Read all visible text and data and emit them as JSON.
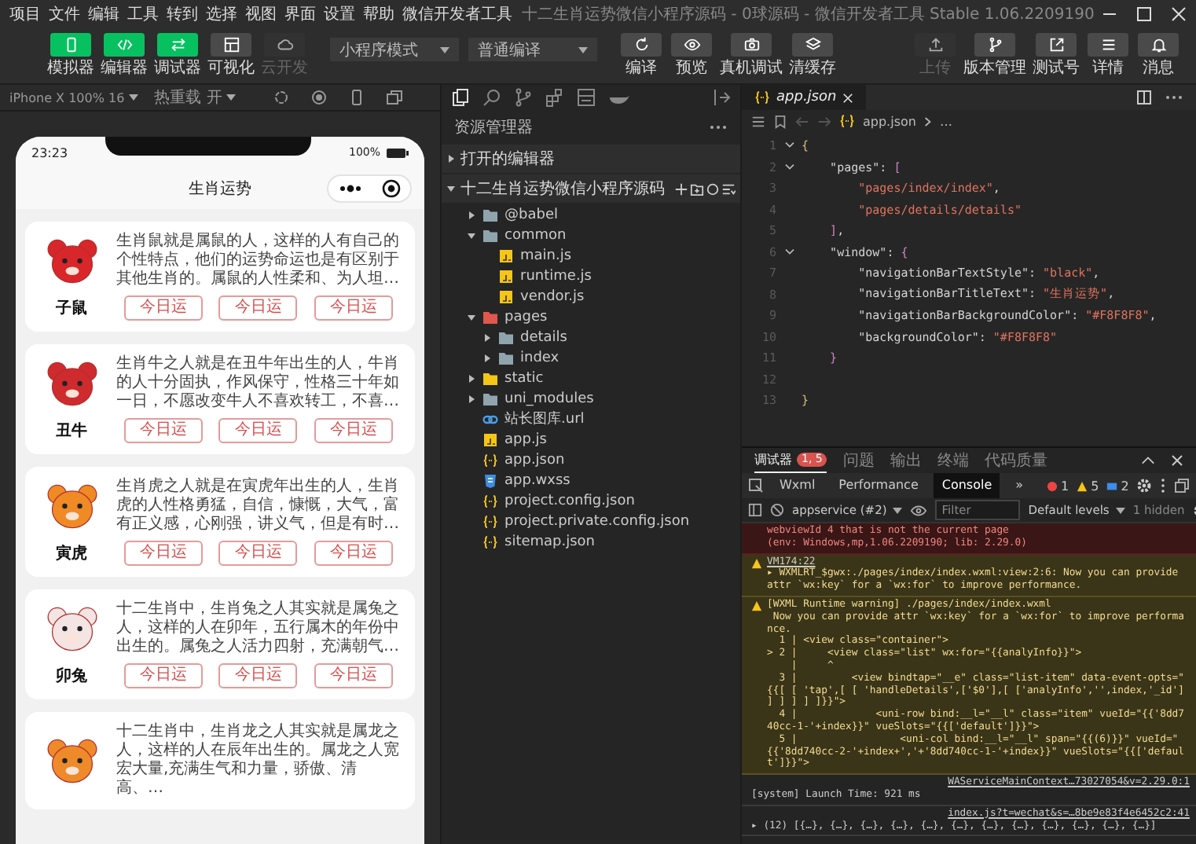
{
  "window": {
    "menu": [
      "项目",
      "文件",
      "编辑",
      "工具",
      "转到",
      "选择",
      "视图",
      "界面",
      "设置",
      "帮助",
      "微信开发者工具"
    ],
    "title": "十二生肖运势微信小程序源码 - 0球源码 - 微信开发者工具 Stable 1.06.2209190"
  },
  "toolbar": {
    "modes": [
      {
        "label": "模拟器",
        "on": true,
        "disabled": false
      },
      {
        "label": "编辑器",
        "on": true,
        "disabled": false
      },
      {
        "label": "调试器",
        "on": true,
        "disabled": false
      },
      {
        "label": "可视化",
        "on": false,
        "disabled": false
      },
      {
        "label": "云开发",
        "on": false,
        "disabled": true
      }
    ],
    "dropdowns": [
      "小程序模式",
      "普通编译"
    ],
    "actions": [
      "编译",
      "预览",
      "真机调试",
      "清缓存"
    ],
    "right": [
      {
        "label": "上传",
        "disabled": true
      },
      {
        "label": "版本管理",
        "disabled": false
      },
      {
        "label": "测试号",
        "disabled": false
      },
      {
        "label": "详情",
        "disabled": false
      },
      {
        "label": "消息",
        "disabled": false
      }
    ]
  },
  "simulator": {
    "device": "iPhone X 100% 16",
    "hot_reload": "热重载 开",
    "phone": {
      "time": "23:23",
      "battery": "100%",
      "title": "生肖运势",
      "cards": [
        {
          "name": "子鼠",
          "color": "#d9262b",
          "description": "生肖鼠就是属鼠的人，这样的人有自己的个性特点，他们的运势命运也是有区别于其他生肖的。属鼠的人性柔和、为人坦…",
          "buttons": [
            "今日运",
            "今日运",
            "今日运"
          ]
        },
        {
          "name": "丑牛",
          "color": "#cf2a2e",
          "description": "生肖牛之人就是在丑牛年出生的人，牛肖的人十分固执，作风保守，性格三十年如一日，不愿改变牛人不喜欢转工，不喜…",
          "buttons": [
            "今日运",
            "今日运",
            "今日运"
          ]
        },
        {
          "name": "寅虎",
          "color": "#f08a24",
          "description": "生肖虎之人就是在寅虎年出生的人，生肖虎的人性格勇猛，自信，慷慨，大气，富有正义感，心刚强，讲义气，但是有时…",
          "buttons": [
            "今日运",
            "今日运",
            "今日运"
          ]
        },
        {
          "name": "卯兔",
          "color": "#f4e4e4",
          "description": "十二生肖中，生肖兔之人其实就是属兔之人，这样的人在卯年，五行属木的年份中出生的。属兔之人活力四射，充满朝气…",
          "buttons": [
            "今日运",
            "今日运",
            "今日运"
          ]
        },
        {
          "color": "#ee8a2a",
          "description": "十二生肖中，生肖龙之人其实就是属龙之人，这样的人在辰年出生的。属龙之人宽宏大量,充满生气和力量，骄傲、清高、…"
        }
      ]
    }
  },
  "explorer": {
    "title": "资源管理器",
    "sections": [
      {
        "label": "打开的编辑器",
        "expanded": false
      },
      {
        "label": "十二生肖运势微信小程序源码",
        "expanded": true
      }
    ],
    "tree": [
      {
        "name": "@babel",
        "kind": "folder",
        "color": "#90a4ae",
        "expanded": false
      },
      {
        "name": "common",
        "kind": "folder",
        "color": "#90a4ae",
        "expanded": true,
        "children": [
          {
            "name": "main.js",
            "kind": "js"
          },
          {
            "name": "runtime.js",
            "kind": "js"
          },
          {
            "name": "vendor.js",
            "kind": "js"
          }
        ]
      },
      {
        "name": "pages",
        "kind": "folder",
        "color": "#e0574f",
        "expanded": true,
        "children": [
          {
            "name": "details",
            "kind": "folder",
            "color": "#90a4ae",
            "expanded": false
          },
          {
            "name": "index",
            "kind": "folder",
            "color": "#90a4ae",
            "expanded": false
          }
        ]
      },
      {
        "name": "static",
        "kind": "folder",
        "color": "#f5c518",
        "expanded": false
      },
      {
        "name": "uni_modules",
        "kind": "folder",
        "color": "#90a4ae",
        "expanded": false
      },
      {
        "name": "站长图库.url",
        "kind": "url"
      },
      {
        "name": "app.js",
        "kind": "js"
      },
      {
        "name": "app.json",
        "kind": "json"
      },
      {
        "name": "app.wxss",
        "kind": "wxss"
      },
      {
        "name": "project.config.json",
        "kind": "json"
      },
      {
        "name": "project.private.config.json",
        "kind": "json"
      },
      {
        "name": "sitemap.json",
        "kind": "json"
      }
    ]
  },
  "editor": {
    "tabs": [
      {
        "label": "app.json",
        "selected": true
      }
    ],
    "breadcrumb": [
      "app.json",
      "…"
    ],
    "lines": [
      {
        "n": "1",
        "fold": true,
        "tokens": [
          {
            "t": "{",
            "kind": "brace"
          }
        ]
      },
      {
        "n": "2",
        "fold": true,
        "tokens": [
          {
            "t": "    \"pages\"",
            "kind": "key"
          },
          {
            "t": ": ",
            "kind": "punct"
          },
          {
            "t": "[",
            "kind": "bracket"
          }
        ]
      },
      {
        "n": "3",
        "fold": false,
        "tokens": [
          {
            "t": "        \"pages/index/index\"",
            "kind": "string"
          },
          {
            "t": ",",
            "kind": "punct"
          }
        ]
      },
      {
        "n": "4",
        "fold": false,
        "tokens": [
          {
            "t": "        \"pages/details/details\"",
            "kind": "string"
          }
        ]
      },
      {
        "n": "5",
        "fold": false,
        "tokens": [
          {
            "t": "    ]",
            "kind": "bracket"
          },
          {
            "t": ",",
            "kind": "punct"
          }
        ]
      },
      {
        "n": "6",
        "fold": true,
        "tokens": [
          {
            "t": "    \"window\"",
            "kind": "key"
          },
          {
            "t": ": ",
            "kind": "punct"
          },
          {
            "t": "{",
            "kind": "bracket"
          }
        ]
      },
      {
        "n": "7",
        "fold": false,
        "tokens": [
          {
            "t": "        \"navigationBarTextStyle\"",
            "kind": "key"
          },
          {
            "t": ": ",
            "kind": "punct"
          },
          {
            "t": "\"black\"",
            "kind": "string"
          },
          {
            "t": ",",
            "kind": "punct"
          }
        ]
      },
      {
        "n": "8",
        "fold": false,
        "tokens": [
          {
            "t": "        \"navigationBarTitleText\"",
            "kind": "key"
          },
          {
            "t": ": ",
            "kind": "punct"
          },
          {
            "t": "\"生肖运势\"",
            "kind": "string"
          },
          {
            "t": ",",
            "kind": "punct"
          }
        ]
      },
      {
        "n": "9",
        "fold": false,
        "tokens": [
          {
            "t": "        \"navigationBarBackgroundColor\"",
            "kind": "key"
          },
          {
            "t": ": ",
            "kind": "punct"
          },
          {
            "t": "\"#F8F8F8\"",
            "kind": "string"
          },
          {
            "t": ",",
            "kind": "punct"
          }
        ]
      },
      {
        "n": "10",
        "fold": false,
        "tokens": [
          {
            "t": "        \"backgroundColor\"",
            "kind": "key"
          },
          {
            "t": ": ",
            "kind": "punct"
          },
          {
            "t": "\"#F8F8F8\"",
            "kind": "string"
          }
        ]
      },
      {
        "n": "11",
        "fold": false,
        "tokens": [
          {
            "t": "    }",
            "kind": "bracket"
          }
        ]
      },
      {
        "n": "12",
        "fold": false
      },
      {
        "n": "13",
        "fold": false,
        "tokens": [
          {
            "t": "}",
            "kind": "brace"
          }
        ]
      }
    ]
  },
  "console": {
    "panel_tabs": [
      {
        "label": "调试器",
        "selected": true,
        "badge": "1, 5"
      },
      {
        "label": "问题",
        "selected": false
      },
      {
        "label": "输出",
        "selected": false
      },
      {
        "label": "终端",
        "selected": false
      },
      {
        "label": "代码质量",
        "selected": false
      }
    ],
    "devtools_tabs": [
      {
        "label": "Wxml",
        "selected": false
      },
      {
        "label": "Performance",
        "selected": false
      },
      {
        "label": "Console",
        "selected": true
      }
    ],
    "more_tabs": "»",
    "counts": {
      "errors": "1",
      "warnings": "5",
      "info": "2"
    },
    "context": "appservice (#2)",
    "filter": {
      "placeholder": "Filter"
    },
    "levels": "Default levels",
    "hidden": "1 hidden",
    "messages": [
      {
        "kind": "error",
        "text": "webviewId 4 that is not the current page\n(env: Windows,mp,1.06.2209190; lib: 2.29.0)"
      },
      {
        "kind": "warning",
        "source": "VM174:22",
        "text": "▸ WXMLRT_$gwx:./pages/index/index.wxml:view:2:6: Now you can provide attr `wx:key` for a `wx:for` to improve performance."
      },
      {
        "kind": "warning",
        "text": "[WXML Runtime warning] ./pages/index/index.wxml\n Now you can provide attr `wx:key` for a `wx:for` to improve performance.\n  1 | <view class=\"container\">\n> 2 |     <view class=\"list\" wx:for=\"{{analyInfo}}\">\n    |     ^\n  3 |         <view bindtap=\"__e\" class=\"list-item\" data-event-opts=\"{{[ [ 'tap',[ [ 'handleDetails',['$0'],[ ['analyInfo','',index,'_id'] ] ] ] ] ]}}\">\n  4 |             <uni-row bind:__l=\"__l\" class=\"item\" vueId=\"{{'8dd740cc-1-'+index}}\" vueSlots=\"{{['default']}}\">\n  5 |                 <uni-col bind:__l=\"__l\" span=\"{{(6)}}\" vueId=\"{{'8dd740cc-2-'+index+','+'8dd740cc-1-'+index}}\" vueSlots=\"{{['default']}}\">"
      },
      {
        "kind": "log",
        "source": "WAServiceMainContext…73027054&v=2.29.0:1",
        "text": "[system] Launch Time: 921 ms"
      },
      {
        "kind": "log",
        "source": "index.js?t=wechat&s=…8be9e83f4e6452c2:41",
        "text": "▸ (12) [{…}, {…}, {…}, {…}, {…}, {…}, {…}, {…}, {…}, {…}, {…}, {…}]"
      }
    ]
  }
}
